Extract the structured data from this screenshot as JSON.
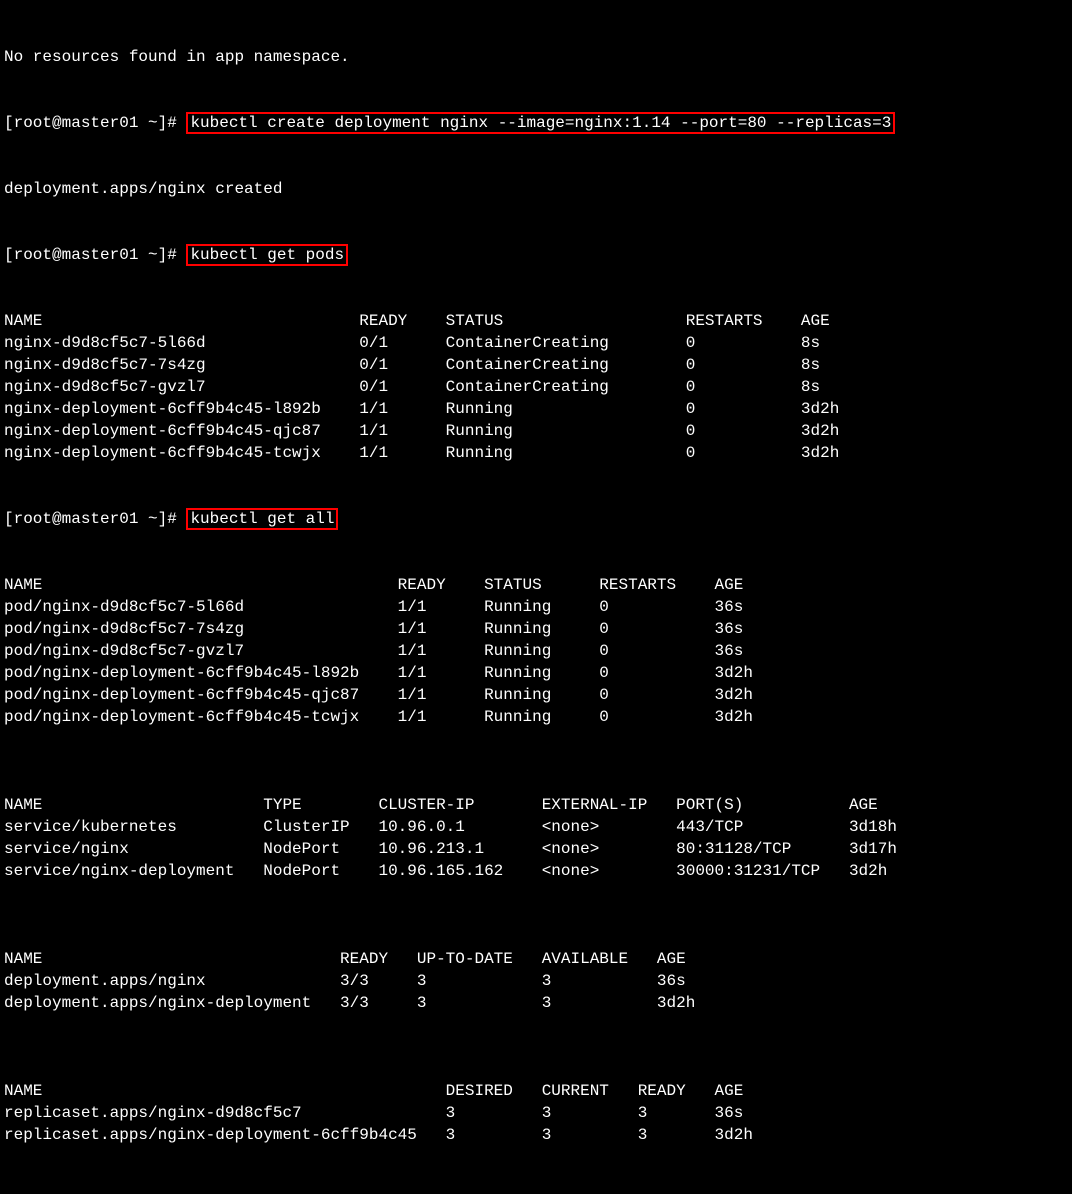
{
  "top_truncated": "No resources found in app namespace.",
  "prompt": "[root@master01 ~]# ",
  "cmd1": "kubectl create deployment nginx --image=nginx:1.14 --port=80 --replicas=3",
  "out1": "deployment.apps/nginx created",
  "cmd2": "kubectl get pods",
  "pods_header": {
    "name": "NAME",
    "ready": "READY",
    "status": "STATUS",
    "restarts": "RESTARTS",
    "age": "AGE"
  },
  "pods_rows": [
    {
      "name": "nginx-d9d8cf5c7-5l66d",
      "ready": "0/1",
      "status": "ContainerCreating",
      "restarts": "0",
      "age": "8s"
    },
    {
      "name": "nginx-d9d8cf5c7-7s4zg",
      "ready": "0/1",
      "status": "ContainerCreating",
      "restarts": "0",
      "age": "8s"
    },
    {
      "name": "nginx-d9d8cf5c7-gvzl7",
      "ready": "0/1",
      "status": "ContainerCreating",
      "restarts": "0",
      "age": "8s"
    },
    {
      "name": "nginx-deployment-6cff9b4c45-l892b",
      "ready": "1/1",
      "status": "Running",
      "restarts": "0",
      "age": "3d2h"
    },
    {
      "name": "nginx-deployment-6cff9b4c45-qjc87",
      "ready": "1/1",
      "status": "Running",
      "restarts": "0",
      "age": "3d2h"
    },
    {
      "name": "nginx-deployment-6cff9b4c45-tcwjx",
      "ready": "1/1",
      "status": "Running",
      "restarts": "0",
      "age": "3d2h"
    }
  ],
  "cmd3": "kubectl get all",
  "all_pods_header": {
    "name": "NAME",
    "ready": "READY",
    "status": "STATUS",
    "restarts": "RESTARTS",
    "age": "AGE"
  },
  "all_pods_rows": [
    {
      "name": "pod/nginx-d9d8cf5c7-5l66d",
      "ready": "1/1",
      "status": "Running",
      "restarts": "0",
      "age": "36s"
    },
    {
      "name": "pod/nginx-d9d8cf5c7-7s4zg",
      "ready": "1/1",
      "status": "Running",
      "restarts": "0",
      "age": "36s"
    },
    {
      "name": "pod/nginx-d9d8cf5c7-gvzl7",
      "ready": "1/1",
      "status": "Running",
      "restarts": "0",
      "age": "36s"
    },
    {
      "name": "pod/nginx-deployment-6cff9b4c45-l892b",
      "ready": "1/1",
      "status": "Running",
      "restarts": "0",
      "age": "3d2h"
    },
    {
      "name": "pod/nginx-deployment-6cff9b4c45-qjc87",
      "ready": "1/1",
      "status": "Running",
      "restarts": "0",
      "age": "3d2h"
    },
    {
      "name": "pod/nginx-deployment-6cff9b4c45-tcwjx",
      "ready": "1/1",
      "status": "Running",
      "restarts": "0",
      "age": "3d2h"
    }
  ],
  "svc_header": {
    "name": "NAME",
    "type": "TYPE",
    "cip": "CLUSTER-IP",
    "eip": "EXTERNAL-IP",
    "ports": "PORT(S)",
    "age": "AGE"
  },
  "svc_rows": [
    {
      "name": "service/kubernetes",
      "type": "ClusterIP",
      "cip": "10.96.0.1",
      "eip": "<none>",
      "ports": "443/TCP",
      "age": "3d18h"
    },
    {
      "name": "service/nginx",
      "type": "NodePort",
      "cip": "10.96.213.1",
      "eip": "<none>",
      "ports": "80:31128/TCP",
      "age": "3d17h"
    },
    {
      "name": "service/nginx-deployment",
      "type": "NodePort",
      "cip": "10.96.165.162",
      "eip": "<none>",
      "ports": "30000:31231/TCP",
      "age": "3d2h"
    }
  ],
  "dep_header": {
    "name": "NAME",
    "ready": "READY",
    "uptodate": "UP-TO-DATE",
    "available": "AVAILABLE",
    "age": "AGE"
  },
  "dep_rows": [
    {
      "name": "deployment.apps/nginx",
      "ready": "3/3",
      "uptodate": "3",
      "available": "3",
      "age": "36s"
    },
    {
      "name": "deployment.apps/nginx-deployment",
      "ready": "3/3",
      "uptodate": "3",
      "available": "3",
      "age": "3d2h"
    }
  ],
  "rs_header": {
    "name": "NAME",
    "desired": "DESIRED",
    "current": "CURRENT",
    "ready": "READY",
    "age": "AGE"
  },
  "rs_rows": [
    {
      "name": "replicaset.apps/nginx-d9d8cf5c7",
      "desired": "3",
      "current": "3",
      "ready": "3",
      "age": "36s"
    },
    {
      "name": "replicaset.apps/nginx-deployment-6cff9b4c45",
      "desired": "3",
      "current": "3",
      "ready": "3",
      "age": "3d2h"
    }
  ]
}
